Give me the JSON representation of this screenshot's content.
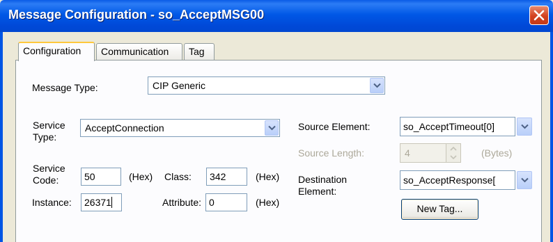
{
  "window": {
    "title": "Message Configuration - so_AcceptMSG00"
  },
  "tabs": [
    {
      "label": "Configuration",
      "active": true
    },
    {
      "label": "Communication",
      "active": false
    },
    {
      "label": "Tag",
      "active": false
    }
  ],
  "form": {
    "message_type_label": "Message Type:",
    "message_type_value": "CIP Generic",
    "service_type_label_1": "Service",
    "service_type_label_2": "Type:",
    "service_type_value": "AcceptConnection",
    "service_code_label_1": "Service",
    "service_code_label_2": "Code:",
    "service_code_value": "50",
    "hex_unit": "(Hex)",
    "class_label": "Class:",
    "class_value": "342",
    "instance_label": "Instance:",
    "instance_value": "26371",
    "attribute_label": "Attribute:",
    "attribute_value": "0",
    "source_element_label": "Source Element:",
    "source_element_value": "so_AcceptTimeout[0]",
    "source_length_label": "Source Length:",
    "source_length_value": "4",
    "bytes_unit": "(Bytes)",
    "destination_label_1": "Destination",
    "destination_label_2": "Element:",
    "destination_value": "so_AcceptResponse[",
    "new_tag_button": "New Tag..."
  },
  "icons": {
    "close": "close-icon",
    "dropdown": "chevron-down-icon",
    "spinner": "spinner-icon"
  },
  "colors": {
    "titlebar": "#0058E6",
    "close_button": "#D2411F",
    "dialog_background": "#ECE9D8",
    "active_tab_accent": "#FFC83C"
  }
}
